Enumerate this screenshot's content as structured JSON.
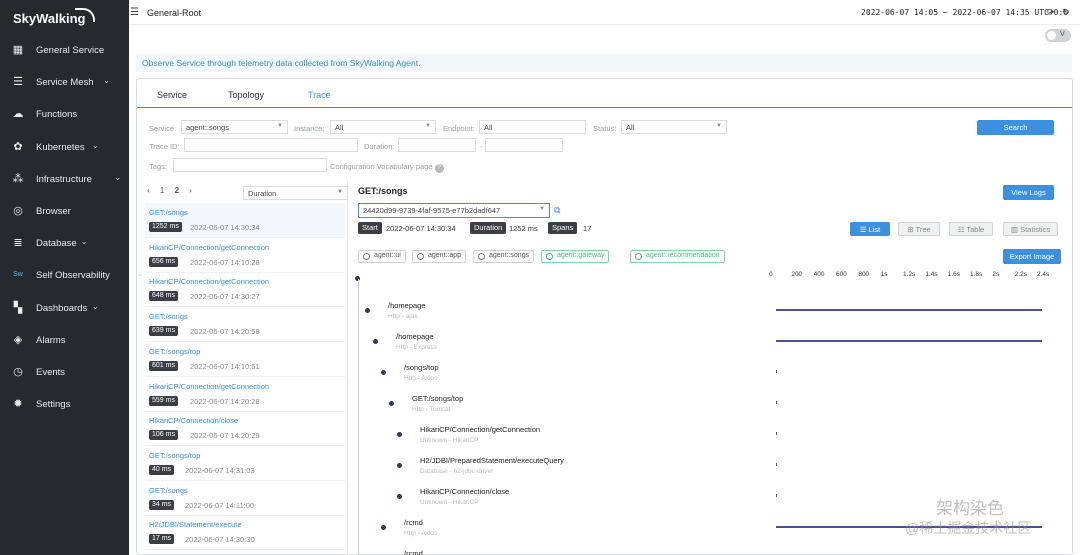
{
  "sidebar": {
    "brand": "SkyWalking",
    "items": [
      {
        "label": "General Service",
        "icon": "service-icon",
        "chevron": false
      },
      {
        "label": "Service Mesh",
        "icon": "mesh-icon",
        "chevron": true
      },
      {
        "label": "Functions",
        "icon": "cloud-icon",
        "chevron": false
      },
      {
        "label": "Kubernetes",
        "icon": "kubernetes-icon",
        "chevron": true
      },
      {
        "label": "Infrastructure",
        "icon": "infrastructure-icon",
        "chevron": true
      },
      {
        "label": "Browser",
        "icon": "globe-icon",
        "chevron": false
      },
      {
        "label": "Database",
        "icon": "database-icon",
        "chevron": true
      },
      {
        "label": "Self Observability",
        "icon": "self-observability-icon",
        "chevron": true
      },
      {
        "label": "Dashboards",
        "icon": "dashboards-icon",
        "chevron": true
      },
      {
        "label": "Alarms",
        "icon": "alarm-icon",
        "chevron": false
      },
      {
        "label": "Events",
        "icon": "events-icon",
        "chevron": false
      },
      {
        "label": "Settings",
        "icon": "gear-icon",
        "chevron": false
      }
    ]
  },
  "header": {
    "title": "General-Root",
    "time_range": "2022-06-07 14:05 ~ 2022-06-07 14:35",
    "timezone": "UTC+0:0",
    "toggle_label": "V"
  },
  "notice": "Observe Service through telemetry data collected from SkyWalking Agent.",
  "tabs": [
    "Service",
    "Topology",
    "Trace"
  ],
  "active_tab": "Trace",
  "filters": {
    "service_label": "Service:",
    "service_value": "agent::songs",
    "instance_label": "Instance:",
    "instance_value": "All",
    "endpoint_label": "Endpoint:",
    "endpoint_value": "All",
    "status_label": "Status:",
    "status_value": "All",
    "search_label": "Search",
    "traceid_label": "Trace ID:",
    "duration_label": "Duration:",
    "duration_sep": "-",
    "tags_label": "Tags:",
    "config_label": "Configuration Vocabulary page"
  },
  "trace_list": {
    "pages": [
      "1",
      "2"
    ],
    "sort_value": "Duration",
    "items": [
      {
        "endpoint": "GET:/songs",
        "duration": "1252 ms",
        "time": "2022-06-07 14:30:34"
      },
      {
        "endpoint": "HikariCP/Connection/getConnection",
        "duration": "656 ms",
        "time": "2022-06-07 14:10:28"
      },
      {
        "endpoint": "HikariCP/Connection/getConnection",
        "duration": "648 ms",
        "time": "2022-06-07 14:30:27"
      },
      {
        "endpoint": "GET:/songs",
        "duration": "639 ms",
        "time": "2022-06-07 14:20:58"
      },
      {
        "endpoint": "GET:/songs/top",
        "duration": "601 ms",
        "time": "2022-06-07 14:10:51"
      },
      {
        "endpoint": "HikariCP/Connection/getConnection",
        "duration": "559 ms",
        "time": "2022-06-07 14:20:28"
      },
      {
        "endpoint": "HikariCP/Connection/close",
        "duration": "106 ms",
        "time": "2022-06-07 14:20:29"
      },
      {
        "endpoint": "GET:/songs/top",
        "duration": "40 ms",
        "time": "2022-06-07 14:31:03"
      },
      {
        "endpoint": "GET:/songs",
        "duration": "34 ms",
        "time": "2022-06-07 14:11:00"
      },
      {
        "endpoint": "H2/JDBI/Statement/execute",
        "duration": "17 ms",
        "time": "2022-06-07 14:30:30"
      }
    ]
  },
  "detail": {
    "title": "GET:/songs",
    "view_logs": "View Logs",
    "trace_id": "24420d99-9739-4faf-9575-e77b2dadf647",
    "start_label": "Start",
    "start_value": "2022-06-07 14:30:34",
    "duration_label": "Duration",
    "duration_value": "1252 ms",
    "spans_label": "Spans",
    "spans_value": "17",
    "views": [
      "List",
      "Tree",
      "Table",
      "Statistics"
    ],
    "active_view": "List",
    "services": [
      {
        "name": "agent::ui",
        "green": false
      },
      {
        "name": "agent::app",
        "green": false
      },
      {
        "name": "agent::songs",
        "green": false
      },
      {
        "name": "agent::gateway",
        "green": true
      },
      {
        "name": "agent::recommendation",
        "green": true
      }
    ],
    "export": "Export Image",
    "axis_ticks": [
      "0",
      "200",
      "400",
      "600",
      "800",
      "1s",
      "1.2s",
      "1.4s",
      "1.6s",
      "1.8s",
      "2s",
      "2.2s",
      "2.4s"
    ],
    "spans": [
      {
        "name": "/homepage",
        "sub": "Http - ajax",
        "start_ms": 0,
        "duration_ms": 2450
      },
      {
        "name": "/homepage",
        "sub": "Http - Express",
        "start_ms": 0,
        "duration_ms": 2450
      },
      {
        "name": "/songs/top",
        "sub": "Http - Axios",
        "start_ms": 0,
        "duration_ms": 5
      },
      {
        "name": "GET:/songs/top",
        "sub": "Http - Tomcat",
        "start_ms": 0,
        "duration_ms": 3
      },
      {
        "name": "HikariCP/Connection/getConnection",
        "sub": "Unknown - HikariCP",
        "start_ms": 0,
        "duration_ms": 2
      },
      {
        "name": "H2/JDBI/PreparedStatement/executeQuery",
        "sub": "Database - h2-jdbc-driver",
        "start_ms": 0,
        "duration_ms": 2
      },
      {
        "name": "HikariCP/Connection/close",
        "sub": "Unknown - HikariCP",
        "start_ms": 0,
        "duration_ms": 2
      },
      {
        "name": "/rcmd",
        "sub": "Http - Axios",
        "start_ms": 0,
        "duration_ms": 2450
      },
      {
        "name": "/rcmd",
        "sub": "",
        "start_ms": 0,
        "duration_ms": 0
      }
    ]
  },
  "watermark": {
    "line1": "架构染色",
    "line2": "@稀土掘金技术社区"
  }
}
